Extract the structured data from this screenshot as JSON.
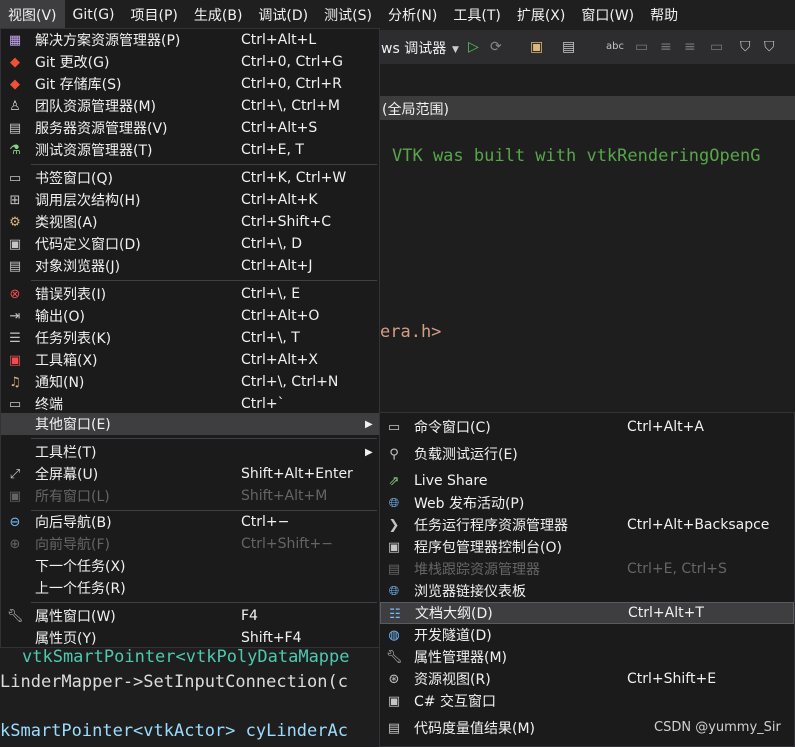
{
  "menubar": {
    "items": [
      "视图(V)",
      "Git(G)",
      "项目(P)",
      "生成(B)",
      "调试(D)",
      "测试(S)",
      "分析(N)",
      "工具(T)",
      "扩展(X)",
      "窗口(W)",
      "帮助"
    ]
  },
  "toolbar": {
    "debugger_label": "ws 调试器",
    "scope_label": "(全局范围)"
  },
  "editor": {
    "line1": "VTK was built with vtkRenderingOpenG",
    "line2": "era.h>",
    "line3_a": "vtkSmartPointer<vtkPolyDataMappe",
    "line4_a": "LinderMapper->SetInputConnection(c",
    "line5_a": "kSmartPointer<vtkActor> cyLinderAc"
  },
  "colors": {
    "menu_bg": "#1b1b1c",
    "hover_bg": "#3e3e40",
    "comment_green": "#57a64a",
    "disabled": "#656565"
  },
  "view_menu": {
    "items": [
      {
        "icon": "solution-explorer-icon",
        "label": "解决方案资源管理器(P)",
        "shortcut": "Ctrl+Alt+L"
      },
      {
        "icon": "git-changes-icon",
        "label": "Git 更改(G)",
        "shortcut": "Ctrl+0, Ctrl+G"
      },
      {
        "icon": "git-repository-icon",
        "label": "Git 存储库(S)",
        "shortcut": "Ctrl+0, Ctrl+R"
      },
      {
        "icon": "team-explorer-icon",
        "label": "团队资源管理器(M)",
        "shortcut": "Ctrl+\\, Ctrl+M"
      },
      {
        "icon": "server-explorer-icon",
        "label": "服务器资源管理器(V)",
        "shortcut": "Ctrl+Alt+S"
      },
      {
        "icon": "test-explorer-icon",
        "label": "测试资源管理器(T)",
        "shortcut": "Ctrl+E, T"
      },
      {
        "icon": "bookmark-window-icon",
        "label": "书签窗口(Q)",
        "shortcut": "Ctrl+K, Ctrl+W"
      },
      {
        "icon": "call-hierarchy-icon",
        "label": "调用层次结构(H)",
        "shortcut": "Ctrl+Alt+K"
      },
      {
        "icon": "class-view-icon",
        "label": "类视图(A)",
        "shortcut": "Ctrl+Shift+C"
      },
      {
        "icon": "code-definition-icon",
        "label": "代码定义窗口(D)",
        "shortcut": "Ctrl+\\, D"
      },
      {
        "icon": "object-browser-icon",
        "label": "对象浏览器(J)",
        "shortcut": "Ctrl+Alt+J"
      },
      {
        "icon": "error-list-icon",
        "label": "错误列表(I)",
        "shortcut": "Ctrl+\\, E"
      },
      {
        "icon": "output-icon",
        "label": "输出(O)",
        "shortcut": "Ctrl+Alt+O"
      },
      {
        "icon": "task-list-icon",
        "label": "任务列表(K)",
        "shortcut": "Ctrl+\\, T"
      },
      {
        "icon": "toolbox-icon",
        "label": "工具箱(X)",
        "shortcut": "Ctrl+Alt+X"
      },
      {
        "icon": "notification-bell-icon",
        "label": "通知(N)",
        "shortcut": "Ctrl+\\, Ctrl+N"
      },
      {
        "icon": "terminal-icon",
        "label": "终端",
        "shortcut": "Ctrl+`"
      },
      {
        "icon": "",
        "label": "其他窗口(E)",
        "shortcut": ""
      },
      {
        "icon": "",
        "label": "工具栏(T)",
        "shortcut": ""
      },
      {
        "icon": "full-screen-icon",
        "label": "全屏幕(U)",
        "shortcut": "Shift+Alt+Enter"
      },
      {
        "icon": "all-windows-icon",
        "label": "所有窗口(L)",
        "shortcut": "Shift+Alt+M"
      },
      {
        "icon": "navigate-back-icon",
        "label": "向后导航(B)",
        "shortcut": "Ctrl+−"
      },
      {
        "icon": "navigate-forward-icon",
        "label": "向前导航(F)",
        "shortcut": "Ctrl+Shift+−"
      },
      {
        "icon": "",
        "label": "下一个任务(X)",
        "shortcut": ""
      },
      {
        "icon": "",
        "label": "上一个任务(R)",
        "shortcut": ""
      },
      {
        "icon": "wrench-icon",
        "label": "属性窗口(W)",
        "shortcut": "F4"
      },
      {
        "icon": "",
        "label": "属性页(Y)",
        "shortcut": "Shift+F4"
      }
    ]
  },
  "other_windows_menu": {
    "items": [
      {
        "icon": "command-window-icon",
        "label": "命令窗口(C)",
        "shortcut": "Ctrl+Alt+A"
      },
      {
        "icon": "load-test-icon",
        "label": "负载测试运行(E)",
        "shortcut": ""
      },
      {
        "icon": "live-share-icon",
        "label": "Live Share",
        "shortcut": ""
      },
      {
        "icon": "web-publish-icon",
        "label": "Web 发布活动(P)",
        "shortcut": ""
      },
      {
        "icon": "chevron-right-icon",
        "label": "任务运行程序资源管理器",
        "shortcut": "Ctrl+Alt+Backsapce"
      },
      {
        "icon": "package-console-icon",
        "label": "程序包管理器控制台(O)",
        "shortcut": ""
      },
      {
        "icon": "stack-trace-icon",
        "label": "堆栈跟踪资源管理器",
        "shortcut": "Ctrl+E, Ctrl+S"
      },
      {
        "icon": "browser-link-icon",
        "label": "浏览器链接仪表板",
        "shortcut": ""
      },
      {
        "icon": "document-outline-icon",
        "label": "文档大纲(D)",
        "shortcut": "Ctrl+Alt+T"
      },
      {
        "icon": "dev-tunnel-icon",
        "label": "开发隧道(D)",
        "shortcut": ""
      },
      {
        "icon": "property-manager-icon",
        "label": "属性管理器(M)",
        "shortcut": ""
      },
      {
        "icon": "resource-view-icon",
        "label": "资源视图(R)",
        "shortcut": "Ctrl+Shift+E"
      },
      {
        "icon": "csharp-interactive-icon",
        "label": "C# 交互窗口",
        "shortcut": ""
      },
      {
        "icon": "code-metrics-icon",
        "label": "代码度量值结果(M)",
        "shortcut": ""
      }
    ]
  },
  "watermark": "CSDN @yummy_Sir"
}
